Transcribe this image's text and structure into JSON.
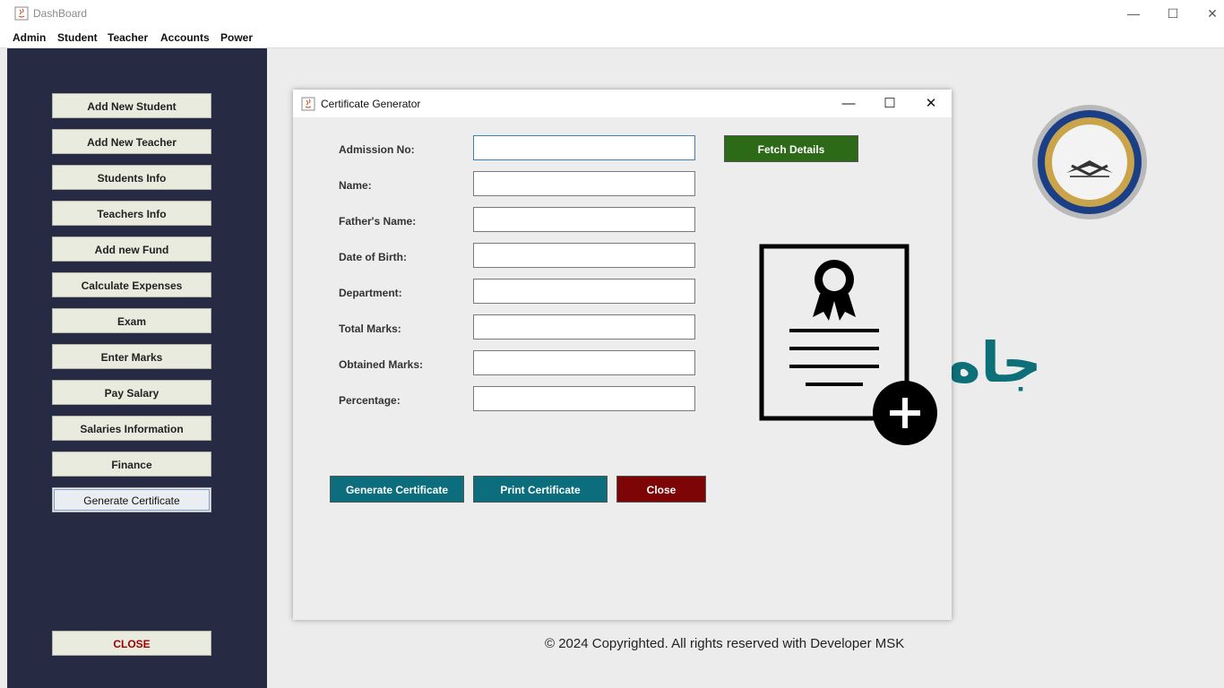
{
  "window": {
    "title": "DashBoard",
    "minimize": "—",
    "maximize": "☐",
    "close": "✕"
  },
  "menubar": [
    "Admin",
    "Student",
    "Teacher",
    "Accounts",
    "Power"
  ],
  "sidebar": {
    "buttons": [
      "Add New Student",
      "Add New Teacher",
      "Students Info",
      "Teachers Info",
      "Add new Fund",
      "Calculate Expenses",
      "Exam",
      "Enter Marks",
      "Pay Salary",
      "Salaries Information",
      "Finance",
      "Generate Certificate"
    ],
    "active": "Generate Certificate",
    "close_label": "CLOSE"
  },
  "background": {
    "arabic_text": "جاه",
    "footer": "© 2024 Copyrighted. All rights reserved with Developer MSK"
  },
  "dialog": {
    "title": "Certificate Generator",
    "fields": [
      {
        "label": "Admission No:",
        "value": ""
      },
      {
        "label": "Name:",
        "value": ""
      },
      {
        "label": "Father's Name:",
        "value": ""
      },
      {
        "label": "Date of Birth:",
        "value": ""
      },
      {
        "label": "Department:",
        "value": ""
      },
      {
        "label": "Total Marks:",
        "value": ""
      },
      {
        "label": "Obtained Marks:",
        "value": ""
      },
      {
        "label": "Percentage:",
        "value": ""
      }
    ],
    "fetch_label": "Fetch Details",
    "generate_label": "Generate Certificate",
    "print_label": "Print Certificate",
    "close_label": "Close"
  },
  "colors": {
    "sidebar": "#262a42",
    "fetch": "#2d6a17",
    "action": "#0c6e7c",
    "close": "#7d0506",
    "brand_text": "#0d6f78"
  },
  "icons": [
    "java-app-icon",
    "certificate-add-icon",
    "institution-logo"
  ]
}
